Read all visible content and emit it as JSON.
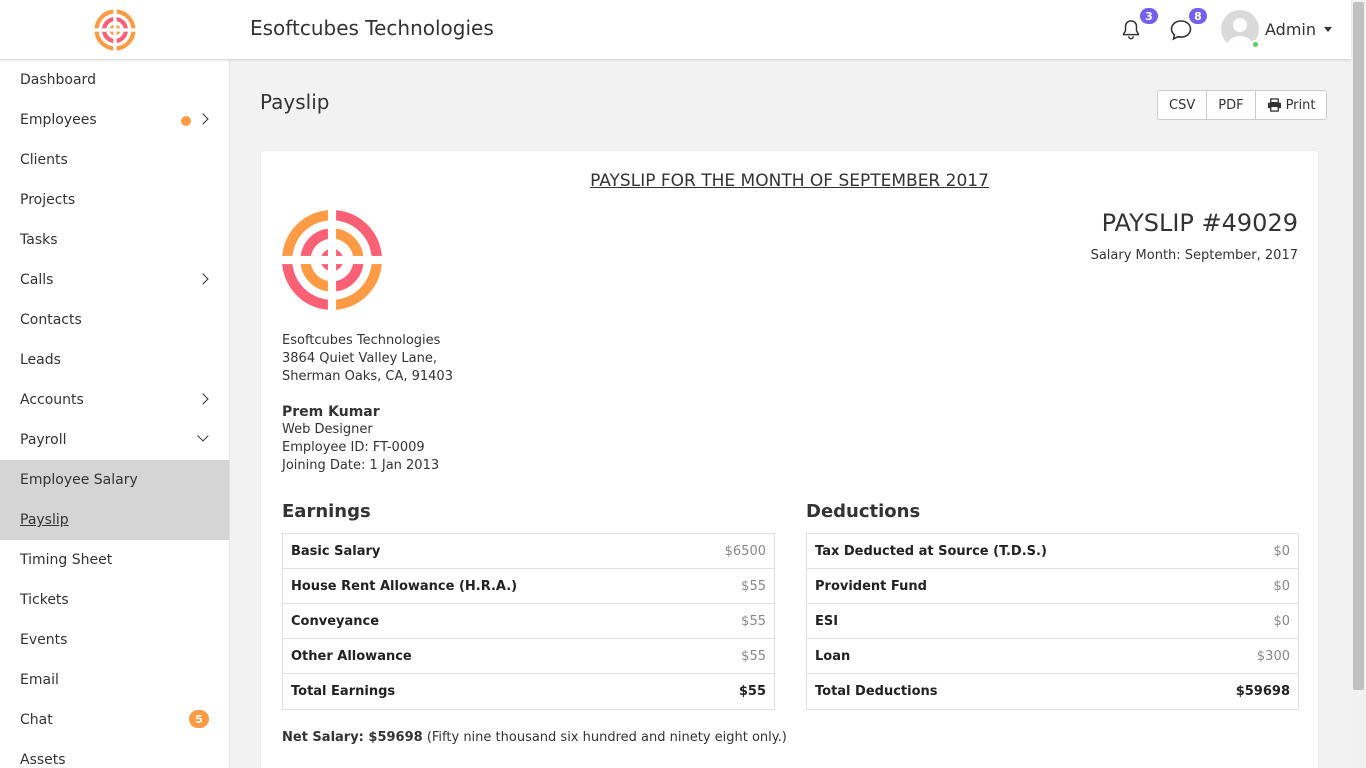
{
  "header": {
    "company": "Esoftcubes Technologies",
    "notifications_count": "3",
    "messages_count": "8",
    "user_name": "Admin"
  },
  "sidebar": {
    "items": [
      {
        "label": "Dashboard"
      },
      {
        "label": "Employees"
      },
      {
        "label": "Clients"
      },
      {
        "label": "Projects"
      },
      {
        "label": "Tasks"
      },
      {
        "label": "Calls"
      },
      {
        "label": "Contacts"
      },
      {
        "label": "Leads"
      },
      {
        "label": "Accounts"
      },
      {
        "label": "Payroll"
      },
      {
        "label": "Employee Salary"
      },
      {
        "label": "Payslip"
      },
      {
        "label": "Timing Sheet"
      },
      {
        "label": "Tickets"
      },
      {
        "label": "Events"
      },
      {
        "label": "Email"
      },
      {
        "label": "Chat",
        "badge": "5"
      },
      {
        "label": "Assets"
      }
    ]
  },
  "page": {
    "title": "Payslip",
    "buttons": {
      "csv": "CSV",
      "pdf": "PDF",
      "print": "Print"
    }
  },
  "payslip": {
    "heading": "PAYSLIP FOR THE MONTH OF SEPTEMBER 2017",
    "number": "PAYSLIP #49029",
    "salary_month": "Salary Month: September, 2017",
    "company": {
      "name": "Esoftcubes Technologies",
      "address1": "3864 Quiet Valley Lane,",
      "address2": "Sherman Oaks, CA, 91403"
    },
    "employee": {
      "name": "Prem Kumar",
      "designation": "Web Designer",
      "id": "Employee ID: FT-0009",
      "joining": "Joining Date: 1 Jan 2013"
    },
    "earnings": {
      "title": "Earnings",
      "rows": [
        {
          "label": "Basic Salary",
          "value": "$6500"
        },
        {
          "label": "House Rent Allowance (H.R.A.)",
          "value": "$55"
        },
        {
          "label": "Conveyance",
          "value": "$55"
        },
        {
          "label": "Other Allowance",
          "value": "$55"
        },
        {
          "label": "Total Earnings",
          "value": "$55"
        }
      ]
    },
    "deductions": {
      "title": "Deductions",
      "rows": [
        {
          "label": "Tax Deducted at Source (T.D.S.)",
          "value": "$0"
        },
        {
          "label": "Provident Fund",
          "value": "$0"
        },
        {
          "label": "ESI",
          "value": "$0"
        },
        {
          "label": "Loan",
          "value": "$300"
        },
        {
          "label": "Total Deductions",
          "value": "$59698"
        }
      ]
    },
    "net_label": "Net Salary: $59698",
    "net_words": "(Fifty nine thousand six hundred and ninety eight only.)"
  },
  "colors": {
    "accent": "#ff9b44",
    "brand_pink": "#fc6075",
    "badge_purple": "#7460ee",
    "online": "#55ce63"
  },
  "icons": {
    "notifications": "bell-icon",
    "messages": "chat-bubble-icon",
    "print": "printer-icon"
  }
}
